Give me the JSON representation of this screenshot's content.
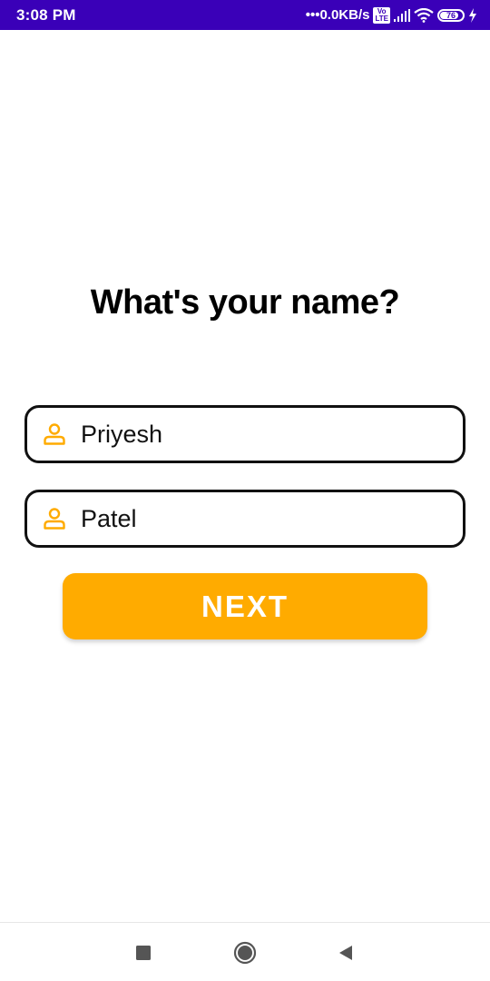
{
  "status_bar": {
    "time": "3:08 PM",
    "network_speed": "•••0.0KB/s",
    "volte_label": "Vo\nLTE",
    "battery_level": "76",
    "background_color": "#3a00b8",
    "icons": [
      "volte-icon",
      "signal-icon",
      "wifi-icon",
      "battery-icon",
      "charging-icon"
    ]
  },
  "main": {
    "title": "What's your name?",
    "first_name": {
      "value": "Priyesh",
      "icon": "person-icon"
    },
    "last_name": {
      "value": "Patel",
      "icon": "person-icon"
    },
    "next_button_label": "NEXT"
  },
  "colors": {
    "accent": "#ffab00",
    "field_border": "#111111",
    "text": "#000000"
  },
  "nav_bar": {
    "icons": [
      "recents-icon",
      "home-icon",
      "back-icon"
    ]
  }
}
